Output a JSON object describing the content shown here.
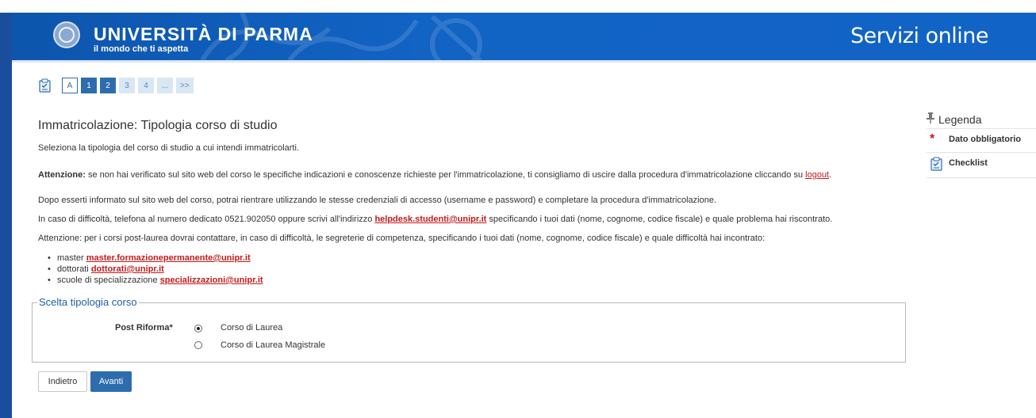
{
  "header": {
    "university_name": "UNIVERSITÀ DI PARMA",
    "tagline": "il mondo che ti aspetta",
    "service_title": "Servizi online"
  },
  "steps": {
    "icon": "clipboard-icon",
    "items": [
      "A",
      "1",
      "2",
      "3",
      "4",
      "...",
      ">>"
    ]
  },
  "page": {
    "title": "Immatricolazione: Tipologia corso di studio",
    "intro": "Seleziona la tipologia del corso di studio a cui intendi immatricolarti.",
    "warning_bold": "Attenzione:",
    "warning_text": " se non hai verificato sul sito web del corso le specifiche indicazioni e conoscenze richieste per l'immatricolazione, ti consigliamo di uscire dalla procedura d'immatricolazione cliccando su ",
    "warning_link": "logout",
    "warning_end": ".",
    "p_return": "Dopo esserti informato sul sito web del corso, potrai rientrare utilizzando le stesse credenziali di accesso (username e password) e completare la procedura d'immatricolazione.",
    "p_help_before": "In caso di difficoltà, telefona al numero dedicato 0521.902050 oppure scrivi all'indirizzo ",
    "p_help_link": "helpdesk.studenti@unipr.it",
    "p_help_after": " specificando i tuoi dati (nome, cognome, codice fiscale) e quale problema hai riscontrato.",
    "p_postlaurea": "Attenzione: per i corsi post-laurea dovrai contattare, in caso di difficoltà, le segreterie di competenza, specificando i tuoi dati (nome, cognome, codice fiscale) e quale difficoltà hai incontrato:",
    "contacts": [
      {
        "label": "master ",
        "email": "master.formazionepermanente@unipr.it"
      },
      {
        "label": "dottorati ",
        "email": "dottorati@unipr.it"
      },
      {
        "label": "scuole di specializzazione ",
        "email": "specializzazioni@unipr.it"
      }
    ]
  },
  "form": {
    "legend": "Scelta tipologia corso",
    "field_label": "Post Riforma*",
    "options": [
      {
        "label": "Corso di Laurea",
        "selected": true
      },
      {
        "label": "Corso di Laurea Magistrale",
        "selected": false
      }
    ],
    "back_label": "Indietro",
    "next_label": "Avanti"
  },
  "legenda": {
    "title": "Legenda",
    "items": [
      {
        "icon": "asterisk-icon",
        "label": "Dato obbligatorio"
      },
      {
        "icon": "clipboard-icon",
        "label": "Checklist"
      }
    ]
  },
  "colors": {
    "header_blue": "#0f5bb8",
    "accent_blue": "#2d6dae",
    "link_red": "#c41a1a"
  }
}
